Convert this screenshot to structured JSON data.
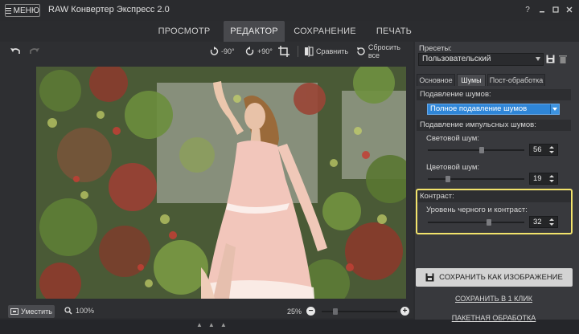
{
  "app": {
    "menu_label": "МЕНЮ",
    "title": "RAW Конвертер Экспресс 2.0"
  },
  "nav": {
    "tabs": [
      {
        "label": "ПРОСМОТР"
      },
      {
        "label": "РЕДАКТОР",
        "active": true
      },
      {
        "label": "СОХРАНЕНИЕ"
      },
      {
        "label": "ПЕЧАТЬ"
      }
    ]
  },
  "toolbar": {
    "rotate_left": "-90°",
    "rotate_right": "+90°",
    "compare": "Сравнить",
    "reset_all": "Сбросить все"
  },
  "status": {
    "fit_label": "Уместить",
    "zoom_100": "100%",
    "zoom_pct": "25%",
    "zoom_level": 0.16
  },
  "panel": {
    "presets_label": "Пресеты:",
    "preset_value": "Пользовательский",
    "tabs": [
      {
        "label": "Основное"
      },
      {
        "label": "Шумы",
        "active": true
      },
      {
        "label": "Пост-обработка"
      }
    ],
    "noise_section": "Подавление шумов:",
    "noise_mode": "Полное подавление шумов",
    "impulse_section": "Подавление импульсных шумов:",
    "luma_label": "Световой шум:",
    "luma_value": "56",
    "luma_level": 0.56,
    "chroma_label": "Цветовой шум:",
    "chroma_value": "19",
    "chroma_level": 0.19,
    "contrast_section": "Контраст:",
    "black_label": "Уровень черного и контраст:",
    "black_value": "32",
    "black_level": 0.64,
    "save_image": "СОХРАНИТЬ КАК ИЗОБРАЖЕНИЕ",
    "save_one_click": "СОХРАНИТЬ В 1 КЛИК",
    "batch": "ПАКЕТНАЯ ОБРАБОТКА"
  },
  "colors": {
    "accent_blue": "#2f86d8",
    "highlight": "#f2e36b",
    "background": "#2b2c2f"
  }
}
